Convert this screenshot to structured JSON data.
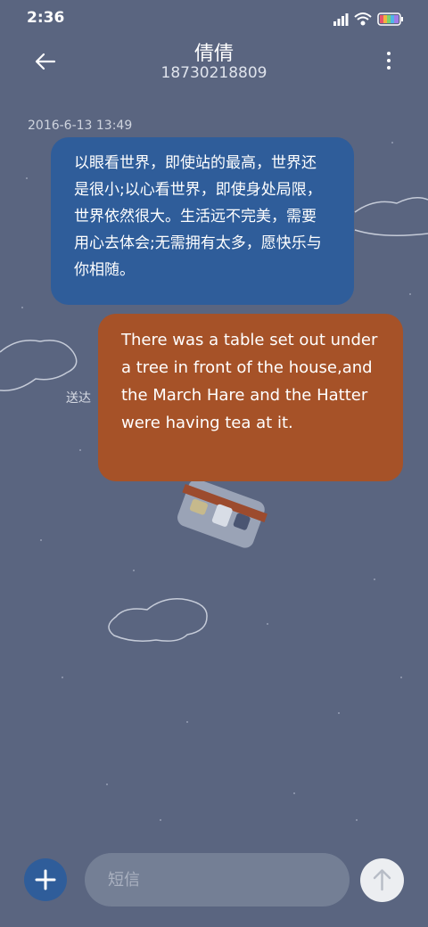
{
  "status_bar": {
    "time": "2:36"
  },
  "header": {
    "contact_name": "倩倩",
    "phone_number": "18730218809",
    "icons": [
      "back-arrow-icon",
      "more-vert-icon"
    ]
  },
  "conversation": {
    "timestamp": "2016-6-13 13:49",
    "messages": [
      {
        "text": "以眼看世界，即使站的最高，世界还是很小;以心看世界，即使身处局限，世界依然很大。生活远不完美，需要用心去体会;无需拥有太多，愿快乐与你相随。",
        "color": "#2f5d9a"
      },
      {
        "text": "There was a table set out under a tree in front of the house,and the March Hare and the Hatter were having tea at it.",
        "color": "#a65228"
      }
    ],
    "status_label": "送达"
  },
  "composer": {
    "placeholder": "短信",
    "icons": [
      "plus-icon",
      "send-arrow-icon"
    ]
  },
  "colors": {
    "background": "#5a6580",
    "accent": "#2f5d9a"
  }
}
